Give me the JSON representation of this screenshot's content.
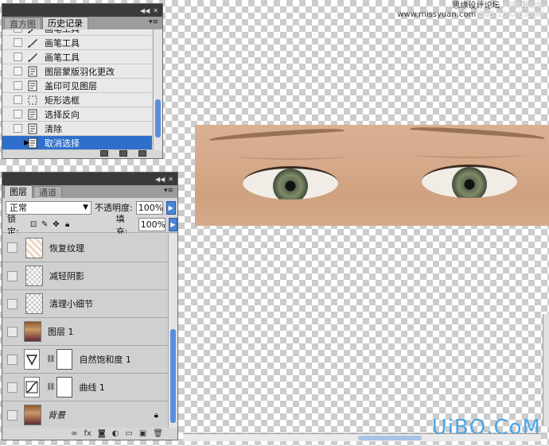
{
  "watermark": {
    "top_line1": "思缘设计论坛",
    "top_line2": "www.missyuan.com",
    "ps_line1": "PS教程论坛",
    "ps_line2": "BBS.16XX8.COM",
    "bottom": "UiBQ.CoM"
  },
  "history_panel": {
    "tabs": [
      {
        "label": "直方图",
        "active": false
      },
      {
        "label": "历史记录",
        "active": true
      }
    ],
    "items": [
      {
        "label": "画笔工具",
        "icon": "brush-icon",
        "selected": false
      },
      {
        "label": "画笔工具",
        "icon": "brush-icon",
        "selected": false
      },
      {
        "label": "画笔工具",
        "icon": "brush-icon",
        "selected": false
      },
      {
        "label": "图层蒙版羽化更改",
        "icon": "document-icon",
        "selected": false
      },
      {
        "label": "盖印可见图层",
        "icon": "document-icon",
        "selected": false
      },
      {
        "label": "矩形选框",
        "icon": "marquee-icon",
        "selected": false
      },
      {
        "label": "选择反向",
        "icon": "document-icon",
        "selected": false
      },
      {
        "label": "清除",
        "icon": "document-icon",
        "selected": false
      },
      {
        "label": "取消选择",
        "icon": "document-icon",
        "selected": true
      }
    ],
    "scroll_fraction": 0.82
  },
  "layers_panel": {
    "tabs": [
      {
        "label": "图层",
        "active": true
      },
      {
        "label": "通道",
        "active": false
      }
    ],
    "blend_mode": "正常",
    "opacity_label": "不透明度:",
    "opacity_value": "100%",
    "lock_label": "锁定:",
    "fill_label": "填充:",
    "fill_value": "100%",
    "layers": [
      {
        "name": "恢复纹理",
        "kind": "pixel-partial",
        "italic": false
      },
      {
        "name": "减轻阴影",
        "kind": "pixel",
        "italic": false
      },
      {
        "name": "清理小细节",
        "kind": "pixel",
        "italic": false
      },
      {
        "name": "图层 1",
        "kind": "photo",
        "italic": false
      },
      {
        "name": "自然饱和度 1",
        "kind": "vibrance",
        "italic": false
      },
      {
        "name": "曲线 1",
        "kind": "curves",
        "italic": false
      },
      {
        "name": "背景",
        "kind": "photo-bg",
        "italic": true,
        "locked": true
      }
    ]
  }
}
